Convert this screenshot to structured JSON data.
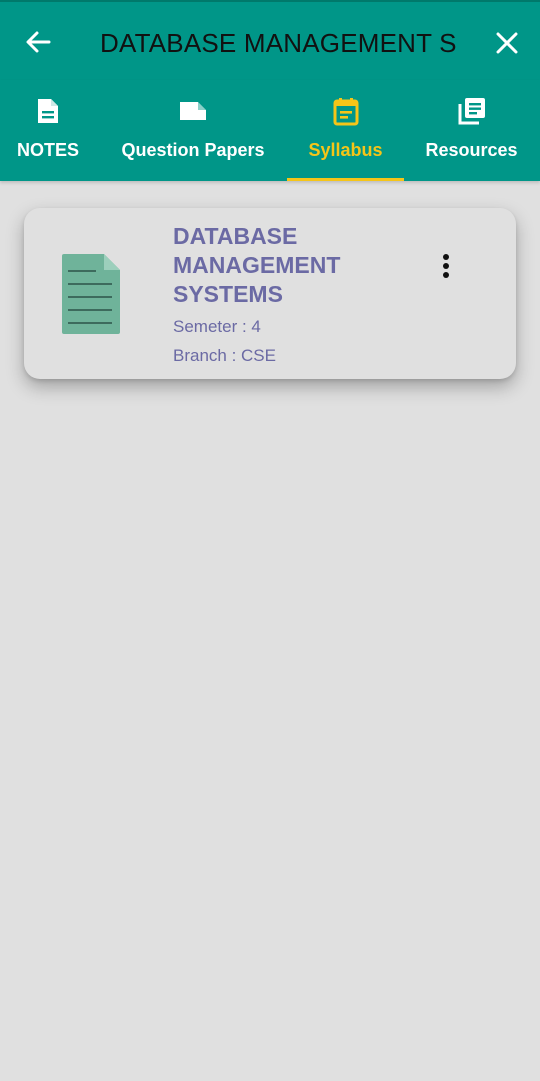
{
  "appbar": {
    "search_value": "DATABASE MANAGEMENT S",
    "back_icon": "arrow-back-icon",
    "close_icon": "close-icon",
    "color": "#009688"
  },
  "tabs": [
    {
      "label": "NOTES",
      "icon": "document-icon",
      "active": false
    },
    {
      "label": "Question Papers",
      "icon": "note-icon",
      "active": false
    },
    {
      "label": "Syllabus",
      "icon": "calendar-icon",
      "active": true
    },
    {
      "label": "Resources",
      "icon": "library-books-icon",
      "active": false
    }
  ],
  "accent_color": "#f5c518",
  "card": {
    "title": "DATABASE MANAGEMENT SYSTEMS",
    "semester": "Semeter : 4",
    "branch": "Branch : CSE",
    "file_icon": "file-document-icon",
    "menu_icon": "more-vert-icon",
    "text_color": "#6b6aa4"
  }
}
